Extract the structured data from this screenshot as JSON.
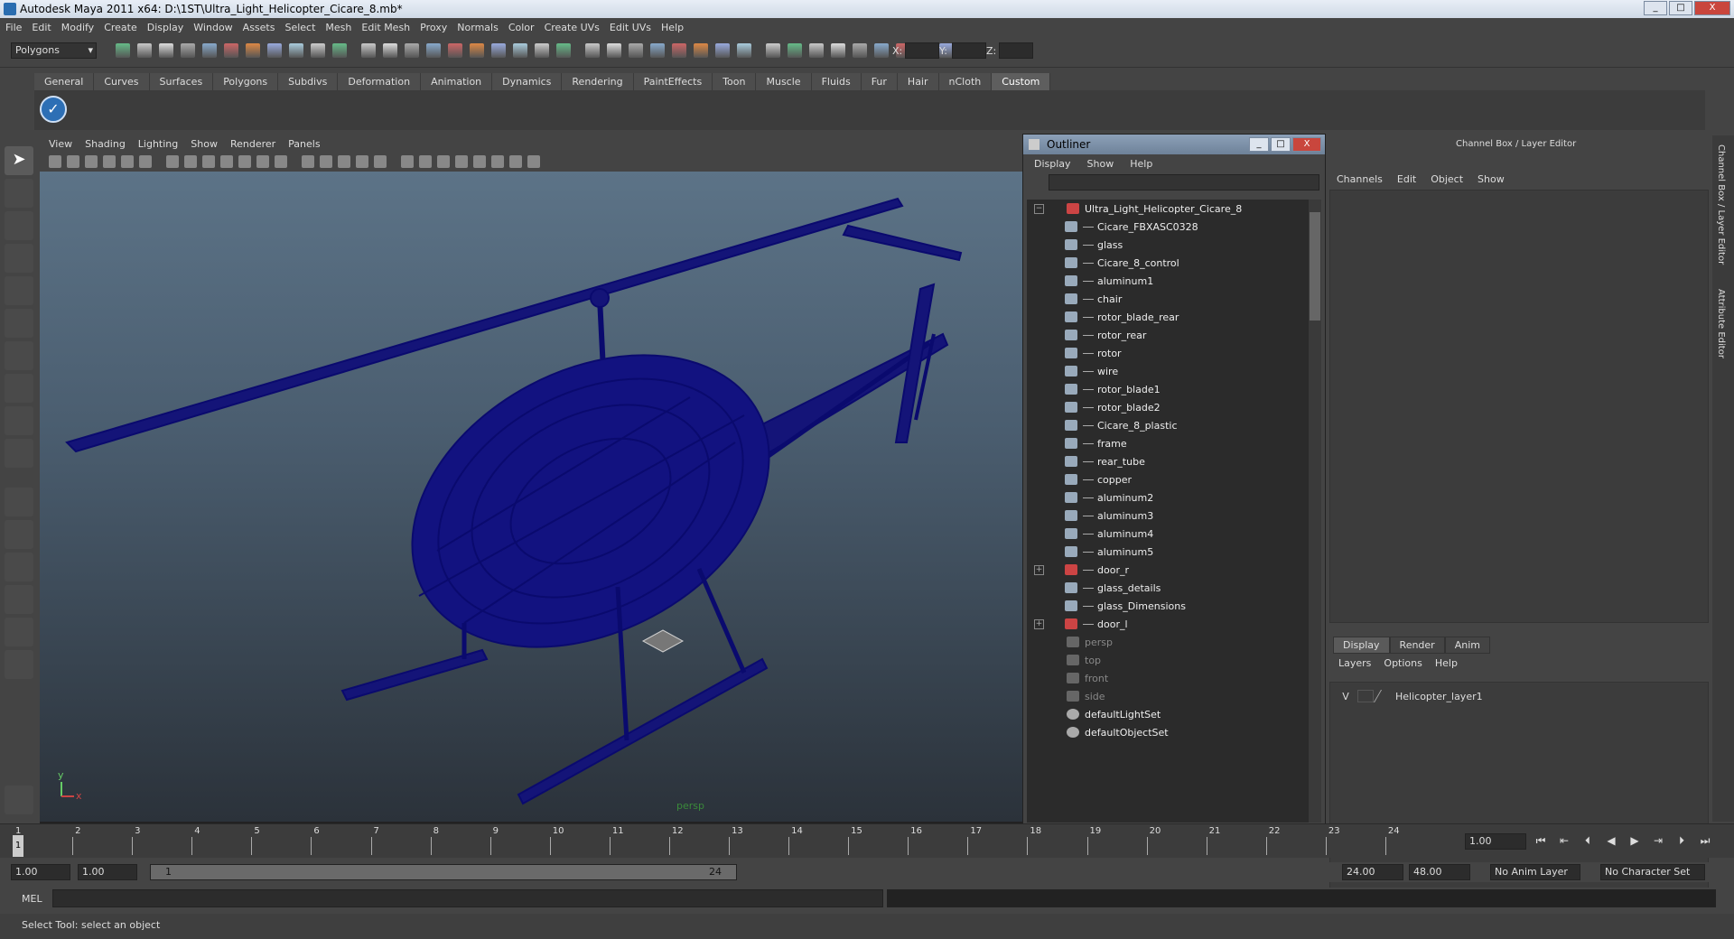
{
  "window": {
    "title": "Autodesk Maya 2011 x64: D:\\1ST\\Ultra_Light_Helicopter_Cicare_8.mb*",
    "buttons": [
      "_",
      "□",
      "X"
    ]
  },
  "menubar": [
    "File",
    "Edit",
    "Modify",
    "Create",
    "Display",
    "Window",
    "Assets",
    "Select",
    "Mesh",
    "Edit Mesh",
    "Proxy",
    "Normals",
    "Color",
    "Create UVs",
    "Edit UVs",
    "Help"
  ],
  "statusline": {
    "mode": "Polygons",
    "x_label": "X:",
    "y_label": "Y:",
    "z_label": "Z:"
  },
  "shelf_tabs": [
    "General",
    "Curves",
    "Surfaces",
    "Polygons",
    "Subdivs",
    "Deformation",
    "Animation",
    "Dynamics",
    "Rendering",
    "PaintEffects",
    "Toon",
    "Muscle",
    "Fluids",
    "Fur",
    "Hair",
    "nCloth",
    "Custom"
  ],
  "shelf_active": "Custom",
  "viewport": {
    "menu": [
      "View",
      "Shading",
      "Lighting",
      "Show",
      "Renderer",
      "Panels"
    ],
    "camera_label": "persp",
    "axis_y": "y",
    "axis_x": "x"
  },
  "outliner": {
    "title": "Outliner",
    "menu": [
      "Display",
      "Show",
      "Help"
    ],
    "items": [
      {
        "label": "Ultra_Light_Helicopter_Cicare_8",
        "level": 0,
        "expander": "−",
        "type": "root"
      },
      {
        "label": "Cicare_FBXASC0328",
        "level": 1,
        "type": "mesh"
      },
      {
        "label": "glass",
        "level": 1,
        "type": "mesh"
      },
      {
        "label": "Cicare_8_control",
        "level": 1,
        "type": "mesh"
      },
      {
        "label": "aluminum1",
        "level": 1,
        "type": "mesh"
      },
      {
        "label": "chair",
        "level": 1,
        "type": "mesh"
      },
      {
        "label": "rotor_blade_rear",
        "level": 1,
        "type": "mesh"
      },
      {
        "label": "rotor_rear",
        "level": 1,
        "type": "mesh"
      },
      {
        "label": "rotor",
        "level": 1,
        "type": "mesh"
      },
      {
        "label": "wire",
        "level": 1,
        "type": "mesh"
      },
      {
        "label": "rotor_blade1",
        "level": 1,
        "type": "mesh"
      },
      {
        "label": "rotor_blade2",
        "level": 1,
        "type": "mesh"
      },
      {
        "label": "Cicare_8_plastic",
        "level": 1,
        "type": "mesh"
      },
      {
        "label": "frame",
        "level": 1,
        "type": "mesh"
      },
      {
        "label": "rear_tube",
        "level": 1,
        "type": "mesh"
      },
      {
        "label": "copper",
        "level": 1,
        "type": "mesh"
      },
      {
        "label": "aluminum2",
        "level": 1,
        "type": "mesh"
      },
      {
        "label": "aluminum3",
        "level": 1,
        "type": "mesh"
      },
      {
        "label": "aluminum4",
        "level": 1,
        "type": "mesh"
      },
      {
        "label": "aluminum5",
        "level": 1,
        "type": "mesh"
      },
      {
        "label": "door_r",
        "level": 1,
        "expander": "+",
        "type": "group"
      },
      {
        "label": "glass_details",
        "level": 1,
        "type": "mesh"
      },
      {
        "label": "glass_Dimensions",
        "level": 1,
        "type": "mesh"
      },
      {
        "label": "door_l",
        "level": 1,
        "expander": "+",
        "type": "group"
      },
      {
        "label": "persp",
        "level": 0,
        "type": "camera"
      },
      {
        "label": "top",
        "level": 0,
        "type": "camera"
      },
      {
        "label": "front",
        "level": 0,
        "type": "camera"
      },
      {
        "label": "side",
        "level": 0,
        "type": "camera"
      },
      {
        "label": "defaultLightSet",
        "level": 0,
        "type": "set"
      },
      {
        "label": "defaultObjectSet",
        "level": 0,
        "type": "set"
      }
    ]
  },
  "channelbox": {
    "title": "Channel Box / Layer Editor",
    "menu": [
      "Channels",
      "Edit",
      "Object",
      "Show"
    ],
    "layer_tabs": [
      "Display",
      "Render",
      "Anim"
    ],
    "layer_active": "Display",
    "layer_menu": [
      "Layers",
      "Options",
      "Help"
    ],
    "layer": {
      "visibility": "V",
      "name": "Helicopter_layer1"
    }
  },
  "side_tabs": [
    "Channel Box / Layer Editor",
    "Attribute Editor"
  ],
  "timeslider": {
    "ticks": [
      "1",
      "2",
      "3",
      "4",
      "5",
      "6",
      "7",
      "8",
      "9",
      "10",
      "11",
      "12",
      "13",
      "14",
      "15",
      "16",
      "17",
      "18",
      "19",
      "20",
      "21",
      "22",
      "23",
      "24"
    ],
    "current": "1",
    "current_time_field": "1.00"
  },
  "range": {
    "start": "1.00",
    "start2": "1.00",
    "slider_start": "1",
    "slider_end": "24",
    "end": "24.00",
    "end2": "48.00",
    "anim_layer": "No Anim Layer",
    "char_set": "No Character Set"
  },
  "cmd": {
    "label": "MEL"
  },
  "help": "Select Tool: select an object",
  "colors": {
    "wire": "#0a0a6e",
    "bg": "#444444"
  }
}
